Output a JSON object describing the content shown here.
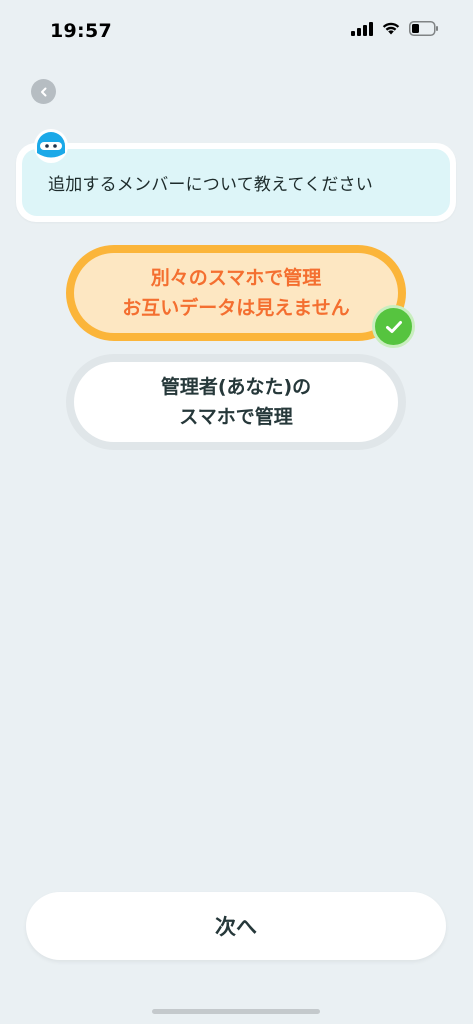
{
  "status_bar": {
    "time": "19:57",
    "icons": [
      "signal-icon",
      "wifi-icon",
      "battery-icon"
    ]
  },
  "nav": {
    "back_icon": "chevron-left-icon"
  },
  "prompt": {
    "mascot_icon": "mascot-icon",
    "text": "追加するメンバーについて教えてください"
  },
  "options": [
    {
      "line1": "別々のスマホで管理",
      "line2": "お互いデータは見えません",
      "selected": true
    },
    {
      "line1": "管理者(あなた)の",
      "line2": "スマホで管理",
      "selected": false
    }
  ],
  "footer": {
    "next_label": "次へ"
  },
  "colors": {
    "background": "#EAF0F3",
    "selected_fill": "#FDE7C2",
    "selected_border": "#FBB53A",
    "selected_text": "#F46F30",
    "check_green": "#56C43F",
    "bubble_fill": "#DDF5F8"
  }
}
